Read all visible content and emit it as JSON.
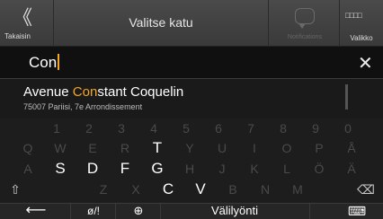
{
  "header": {
    "back_glyph": "《",
    "back_label": "Takaisin",
    "title": "Valitse katu",
    "notifications_label": "Notifications",
    "menu_glyph": "□□□□",
    "menu_label": "Valikko"
  },
  "search": {
    "value": "Con",
    "clear_glyph": "✕"
  },
  "results": [
    {
      "pre": "Avenue ",
      "match": "Con",
      "post": "stant Coquelin",
      "sub": "75007 Pariisi, 7e Arrondissement"
    }
  ],
  "keyboard": {
    "row1": [
      "1",
      "2",
      "3",
      "4",
      "5",
      "6",
      "7",
      "8",
      "9",
      "0"
    ],
    "row2": [
      "Q",
      "W",
      "E",
      "R",
      "T",
      "Y",
      "U",
      "I",
      "O",
      "P",
      "Å"
    ],
    "row3": [
      "A",
      "S",
      "D",
      "F",
      "G",
      "H",
      "J",
      "K",
      "L",
      "Ö",
      "Ä"
    ],
    "row4": [
      "⇧",
      "Z",
      "X",
      "C",
      "V",
      "B",
      "N",
      "M",
      "⌫"
    ],
    "bottom": {
      "back": "⟵",
      "symbols": "ø/!",
      "globe": "⊕",
      "space": "Välilyönti",
      "kbd": "⌨"
    },
    "active_keys": [
      "T",
      "S",
      "D",
      "F",
      "G",
      "C",
      "V"
    ]
  },
  "colors": {
    "highlight": "#f5a623"
  }
}
